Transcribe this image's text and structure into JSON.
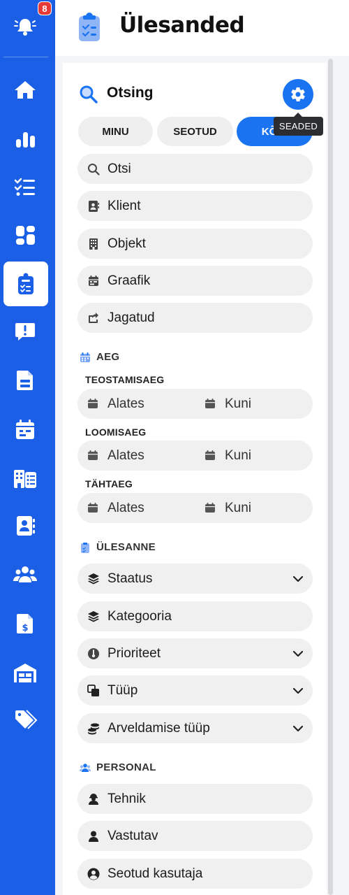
{
  "sidebar": {
    "notification_count": "8",
    "items": [
      {
        "icon": "bell-icon"
      },
      {
        "icon": "home-icon"
      },
      {
        "icon": "bar-chart-icon"
      },
      {
        "icon": "checklist-icon"
      },
      {
        "icon": "dashboard-icon"
      },
      {
        "icon": "clipboard-task-icon",
        "active": true
      },
      {
        "icon": "alert-message-icon"
      },
      {
        "icon": "document-icon"
      },
      {
        "icon": "calendar-icon"
      },
      {
        "icon": "buildings-list-icon"
      },
      {
        "icon": "contact-book-icon"
      },
      {
        "icon": "users-icon"
      },
      {
        "icon": "invoice-dollar-icon"
      },
      {
        "icon": "warehouse-icon"
      },
      {
        "icon": "tags-icon"
      }
    ]
  },
  "header": {
    "title": "Ülesanded"
  },
  "search": {
    "title": "Otsing",
    "settings_tooltip": "SEADED",
    "tabs": [
      {
        "label": "MINU",
        "active": false
      },
      {
        "label": "SEOTUD",
        "active": false
      },
      {
        "label": "KÕIK",
        "active": true
      }
    ],
    "fields": [
      {
        "label": "Otsi",
        "icon": "search-icon"
      },
      {
        "label": "Klient",
        "icon": "contact-card-icon"
      },
      {
        "label": "Objekt",
        "icon": "building-icon"
      },
      {
        "label": "Graafik",
        "icon": "calendar-icon"
      },
      {
        "label": "Jagatud",
        "icon": "share-icon"
      }
    ]
  },
  "time": {
    "section_label": "AEG",
    "groups": [
      {
        "label": "TEOSTAMISAEG",
        "from": "Alates",
        "to": "Kuni"
      },
      {
        "label": "LOOMISAEG",
        "from": "Alates",
        "to": "Kuni"
      },
      {
        "label": "TÄHTAEG",
        "from": "Alates",
        "to": "Kuni"
      }
    ]
  },
  "task": {
    "section_label": "ÜLESANNE",
    "fields": [
      {
        "label": "Staatus",
        "icon": "layers-icon",
        "dropdown": true
      },
      {
        "label": "Kategooria",
        "icon": "layers-icon",
        "dropdown": false
      },
      {
        "label": "Prioriteet",
        "icon": "thermometer-icon",
        "dropdown": true
      },
      {
        "label": "Tüüp",
        "icon": "clone-icon",
        "dropdown": true
      },
      {
        "label": "Arveldamise tüüp",
        "icon": "coins-icon",
        "dropdown": true
      }
    ]
  },
  "personal": {
    "section_label": "PERSONAL",
    "fields": [
      {
        "label": "Tehnik",
        "icon": "technician-icon"
      },
      {
        "label": "Vastutav",
        "icon": "user-icon"
      },
      {
        "label": "Seotud kasutaja",
        "icon": "user-circle-icon"
      }
    ]
  },
  "colors": {
    "sidebar": "#1a5fe6",
    "accent": "#1a73f0",
    "field_bg": "#f0f0f0",
    "badge": "#e53935"
  }
}
